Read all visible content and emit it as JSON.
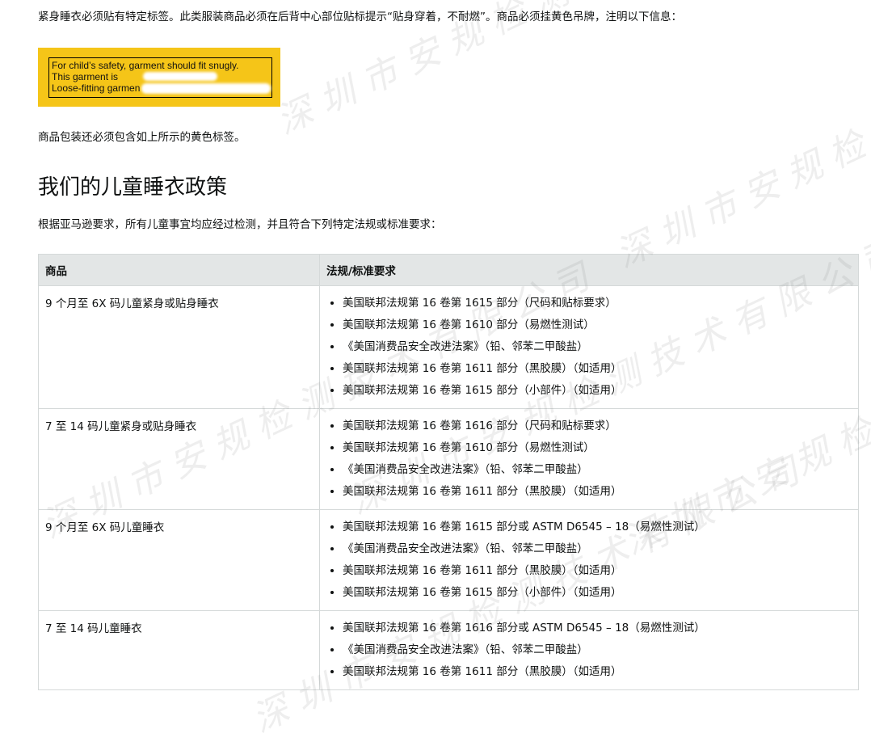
{
  "intro_text": "紧身睡衣必须贴有特定标签。此类服装商品必须在后背中心部位贴标提示“贴身穿着，不耐燃”。商品必须挂黄色吊牌，注明以下信息：",
  "hangtag": {
    "line1": "For child’s safety, garment should fit snugly.",
    "line2": "This garment is",
    "line3": "Loose-fitting garmen",
    "color": "#f5c518"
  },
  "packaging_text": "商品包装还必须包含如上所示的黄色标签。",
  "section_title": "我们的儿童睡衣政策",
  "lead_text": "根据亚马逊要求，所有儿童事宜均应经过检测，并且符合下列特定法规或标准要求：",
  "table": {
    "headers": [
      "商品",
      "法规/标准要求"
    ],
    "rows": [
      {
        "product": "9 个月至 6X 码儿童紧身或贴身睡衣",
        "requirements": [
          "美国联邦法规第 16 卷第 1615 部分（尺码和贴标要求）",
          "美国联邦法规第 16 卷第 1610 部分（易燃性测试）",
          "《美国消费品安全改进法案》（铅、邻苯二甲酸盐）",
          "美国联邦法规第 16 卷第 1611 部分（黑胶膜）（如适用）",
          "美国联邦法规第 16 卷第 1615 部分（小部件）（如适用）"
        ]
      },
      {
        "product": "7 至 14 码儿童紧身或贴身睡衣",
        "requirements": [
          "美国联邦法规第 16 卷第 1616 部分（尺码和贴标要求）",
          "美国联邦法规第 16 卷第 1610 部分（易燃性测试）",
          "《美国消费品安全改进法案》（铅、邻苯二甲酸盐）",
          "美国联邦法规第 16 卷第 1611 部分（黑胶膜）（如适用）"
        ]
      },
      {
        "product": "9 个月至 6X 码儿童睡衣",
        "requirements": [
          "美国联邦法规第 16 卷第 1615 部分或 ASTM D6545 – 18（易燃性测试）",
          "《美国消费品安全改进法案》（铅、邻苯二甲酸盐）",
          "美国联邦法规第 16 卷第 1611 部分（黑胶膜）（如适用）",
          "美国联邦法规第 16 卷第 1615 部分（小部件）（如适用）"
        ]
      },
      {
        "product": "7 至 14 码儿童睡衣",
        "requirements": [
          "美国联邦法规第 16 卷第 1616 部分或 ASTM D6545 – 18（易燃性测试）",
          "《美国消费品安全改进法案》（铅、邻苯二甲酸盐）",
          "美国联邦法规第 16 卷第 1611 部分（黑胶膜）（如适用）"
        ]
      }
    ]
  },
  "watermark_text": "深圳市安规检测技术有限公司"
}
